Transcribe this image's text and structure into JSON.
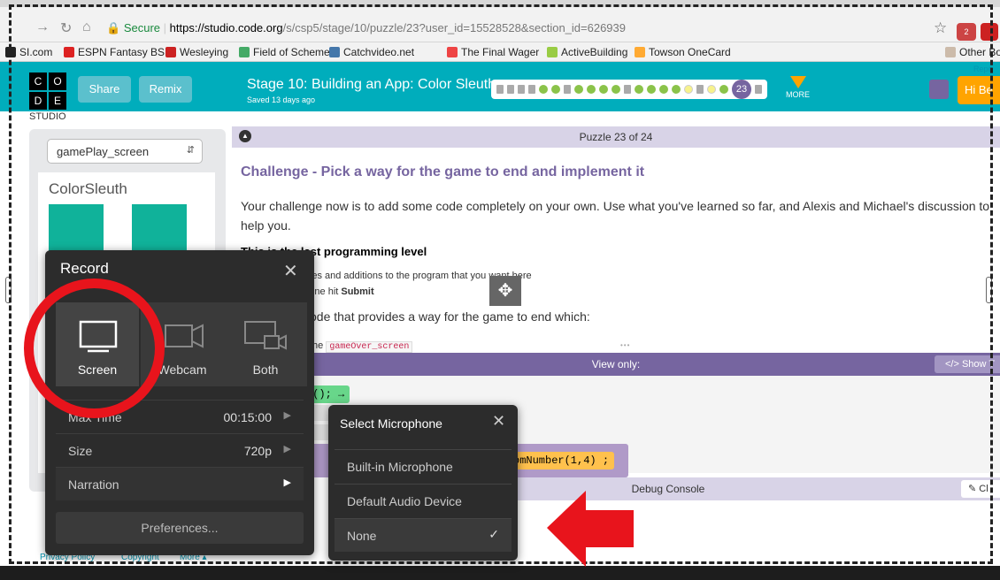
{
  "browser": {
    "url_secure": "Secure",
    "url_host": "https://studio.code.org",
    "url_path": "/s/csp5/stage/10/puzzle/23?user_id=15528528&section_id=626939",
    "bookmarks": [
      "SI.com",
      "ESPN Fantasy BSB",
      "Wesleying",
      "Field of Schemes",
      "Catchvideo.net",
      "The Final Wager",
      "ActiveBuilding",
      "Towson OneCard"
    ],
    "other_bookmarks": "Other Bo",
    "ext_badge": "2"
  },
  "header": {
    "logo_letters": [
      "C",
      "O",
      "D",
      "E"
    ],
    "studio": "STUDIO",
    "share": "Share",
    "remix": "Remix",
    "stage_title": "Stage 10: Building an App: Color Sleuth",
    "saved": "Saved 13 days ago",
    "current_level": "23",
    "more": "MORE",
    "hi": "Hi Be",
    "report": "Repo"
  },
  "app": {
    "screen_select": "gamePlay_screen",
    "screen_title": "ColorSleuth"
  },
  "instructions": {
    "puzzle": "Puzzle 23 of 24",
    "title": "Challenge - Pick a way for the game to end and implement it",
    "body": "Your challenge now is to add some code completely on your own. Use what you've learned so far, and Alexis and Michael's discussion to help you.",
    "heading": "This is the last programming level",
    "li1": "anges and additions to the program that you want here",
    "li2_prefix": "e done hit ",
    "li2_bold": "Submit",
    "para": "ode that provides a way for the game to end which:",
    "li3_prefix": "the ",
    "li3_code": "gameOver_screen"
  },
  "workspace": {
    "view_only": "View only:",
    "show_text": "Show T",
    "block1": "d(); →",
    "block_rand": "omNumber(1,4) ;",
    "debug": "Debug Console",
    "clear": "Cl"
  },
  "footer": {
    "privacy": "Privacy Policy",
    "copyright": "Copyright",
    "more": "More ▴"
  },
  "record_panel": {
    "title": "Record",
    "modes": [
      "Screen",
      "Webcam",
      "Both"
    ],
    "selected_mode": "Screen",
    "rows": [
      {
        "label": "Max Time",
        "value": "00:15:00"
      },
      {
        "label": "Size",
        "value": "720p"
      },
      {
        "label": "Narration",
        "value": ""
      }
    ],
    "preferences": "Preferences..."
  },
  "mic_menu": {
    "title": "Select Microphone",
    "options": [
      "Built-in Microphone",
      "Default Audio Device",
      "None"
    ],
    "selected": "None"
  },
  "colors": {
    "teal": "#00adbc",
    "purple": "#7665a0",
    "orange": "#ffa400",
    "highlight_red": "#e8141c"
  }
}
